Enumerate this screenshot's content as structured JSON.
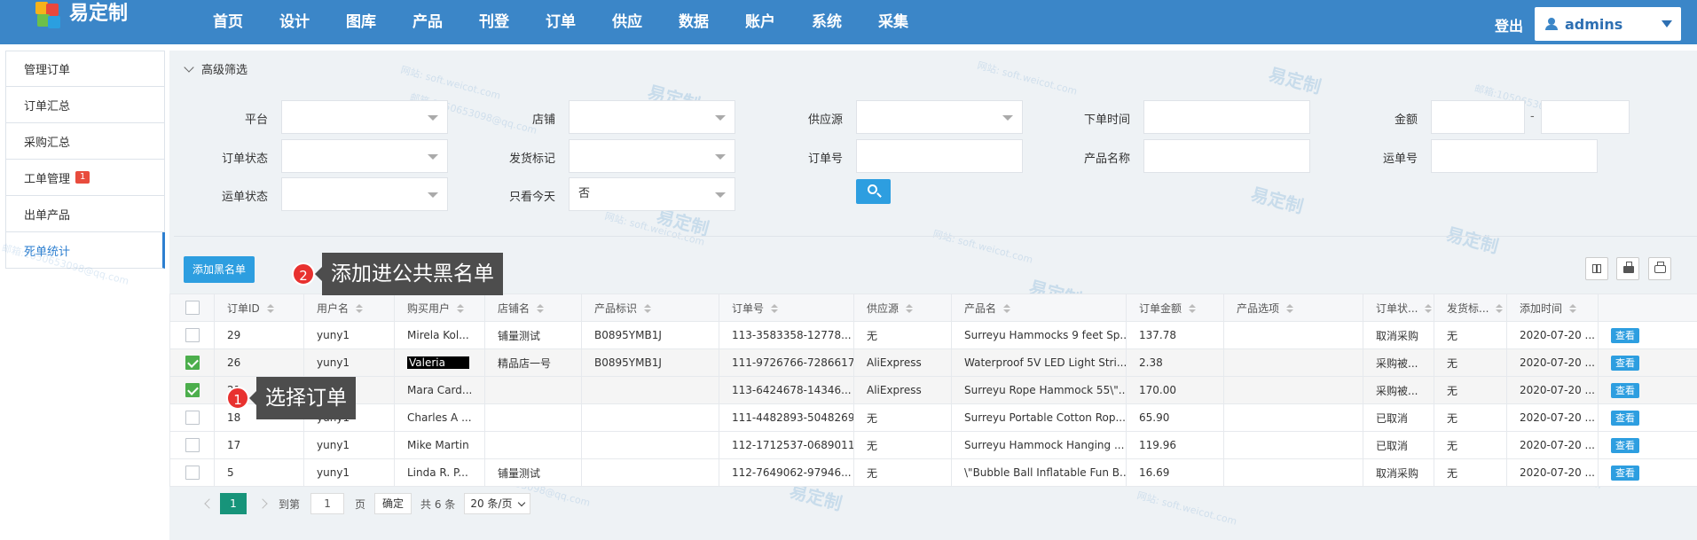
{
  "header": {
    "logo_text": "易定制",
    "nav": [
      "首页",
      "设计",
      "图库",
      "产品",
      "刊登",
      "订单",
      "供应",
      "数据",
      "账户",
      "系统",
      "采集"
    ],
    "logout": "登出",
    "user": "admins"
  },
  "sidebar": {
    "items": [
      {
        "label": "管理订单"
      },
      {
        "label": "订单汇总"
      },
      {
        "label": "采购汇总"
      },
      {
        "label": "工单管理",
        "badge": "1"
      },
      {
        "label": "出单产品"
      },
      {
        "label": "死单统计"
      }
    ]
  },
  "filter": {
    "title": "高级筛选",
    "platform": "平台",
    "shop": "店铺",
    "supplier": "供应源",
    "order_time": "下单时间",
    "amount": "金额",
    "amount_dash": "-",
    "order_status": "订单状态",
    "ship_mark": "发货标记",
    "order_no": "订单号",
    "product_name": "产品名称",
    "tracking_no": "运单号",
    "tracking_status": "运单状态",
    "today_only": "只看今天",
    "today_only_value": "否"
  },
  "toolbar": {
    "add_blacklist": "添加黑名单"
  },
  "table": {
    "headers": [
      "订单ID",
      "用户名",
      "购买用户",
      "店铺名",
      "产品标识",
      "订单号",
      "供应源",
      "产品名",
      "订单金额",
      "产品选项",
      "订单状...",
      "发货标...",
      "添加时间"
    ],
    "rows": [
      {
        "id": "29",
        "user": "yuny1",
        "buyer": "Mirela Kol...",
        "shop": "铺量测试",
        "sku": "B0895YMB1J",
        "order": "113-3583358-12778...",
        "supplier": "无",
        "product": "Surreyu Hammocks 9 feet Sp...",
        "amount": "137.78",
        "option": "",
        "status": "取消采购",
        "ship": "无",
        "time": "2020-07-20 ...",
        "action": "查看",
        "checked": false
      },
      {
        "id": "26",
        "user": "yuny1",
        "buyer": "Valeria",
        "shop": "精品店一号",
        "sku": "B0895YMB1J",
        "order": "111-9726766-7286617",
        "supplier": "AliExpress",
        "product": "Waterproof 5V LED Light Stri...",
        "amount": "2.38",
        "option": "",
        "status": "采购被...",
        "ship": "无",
        "time": "2020-07-20 ...",
        "action": "查看",
        "checked": true
      },
      {
        "id": "21",
        "user": "yuny1",
        "buyer": "Mara Card...",
        "shop": "",
        "sku": "",
        "order": "113-6424678-14346...",
        "supplier": "AliExpress",
        "product": "Surreyu Rope Hammock 55\\\"...",
        "amount": "170.00",
        "option": "",
        "status": "采购被...",
        "ship": "无",
        "time": "2020-07-20 ...",
        "action": "查看",
        "checked": true
      },
      {
        "id": "18",
        "user": "yuny1",
        "buyer": "Charles A ...",
        "shop": "",
        "sku": "",
        "order": "111-4482893-5048269",
        "supplier": "无",
        "product": "Surreyu Portable Cotton Rop...",
        "amount": "65.90",
        "option": "",
        "status": "已取消",
        "ship": "无",
        "time": "2020-07-20 ...",
        "action": "查看",
        "checked": false
      },
      {
        "id": "17",
        "user": "yuny1",
        "buyer": "Mike Martin",
        "shop": "",
        "sku": "",
        "order": "112-1712537-0689011",
        "supplier": "无",
        "product": "Surreyu Hammock Hanging ...",
        "amount": "119.96",
        "option": "",
        "status": "已取消",
        "ship": "无",
        "time": "2020-07-20 ...",
        "action": "查看",
        "checked": false
      },
      {
        "id": "5",
        "user": "yuny1",
        "buyer": "Linda R. P...",
        "shop": "铺量测试",
        "sku": "",
        "order": "112-7649062-97946...",
        "supplier": "无",
        "product": "\\\"Bubble Ball Inflatable Fun B...",
        "amount": "16.69",
        "option": "",
        "status": "取消采购",
        "ship": "无",
        "time": "2020-07-20 ...",
        "action": "查看",
        "checked": false
      }
    ]
  },
  "pager": {
    "page": "1",
    "goto": "到第",
    "page_input": "1",
    "page_unit": "页",
    "ok": "确定",
    "total": "共 6 条",
    "size": "20 条/页"
  },
  "annotations": [
    {
      "num": "1",
      "text": "选择订单"
    },
    {
      "num": "2",
      "text": "添加进公共黑名单"
    }
  ],
  "watermark": {
    "brand": "易定制",
    "site": "网站: soft.weicot.com",
    "mail": "邮箱:1050653098@qq.com"
  },
  "colors": {
    "header": "#3b86c8",
    "accent": "#2d9ee0",
    "pager_active": "#17947a",
    "annotation_dot": "#e8312f"
  }
}
